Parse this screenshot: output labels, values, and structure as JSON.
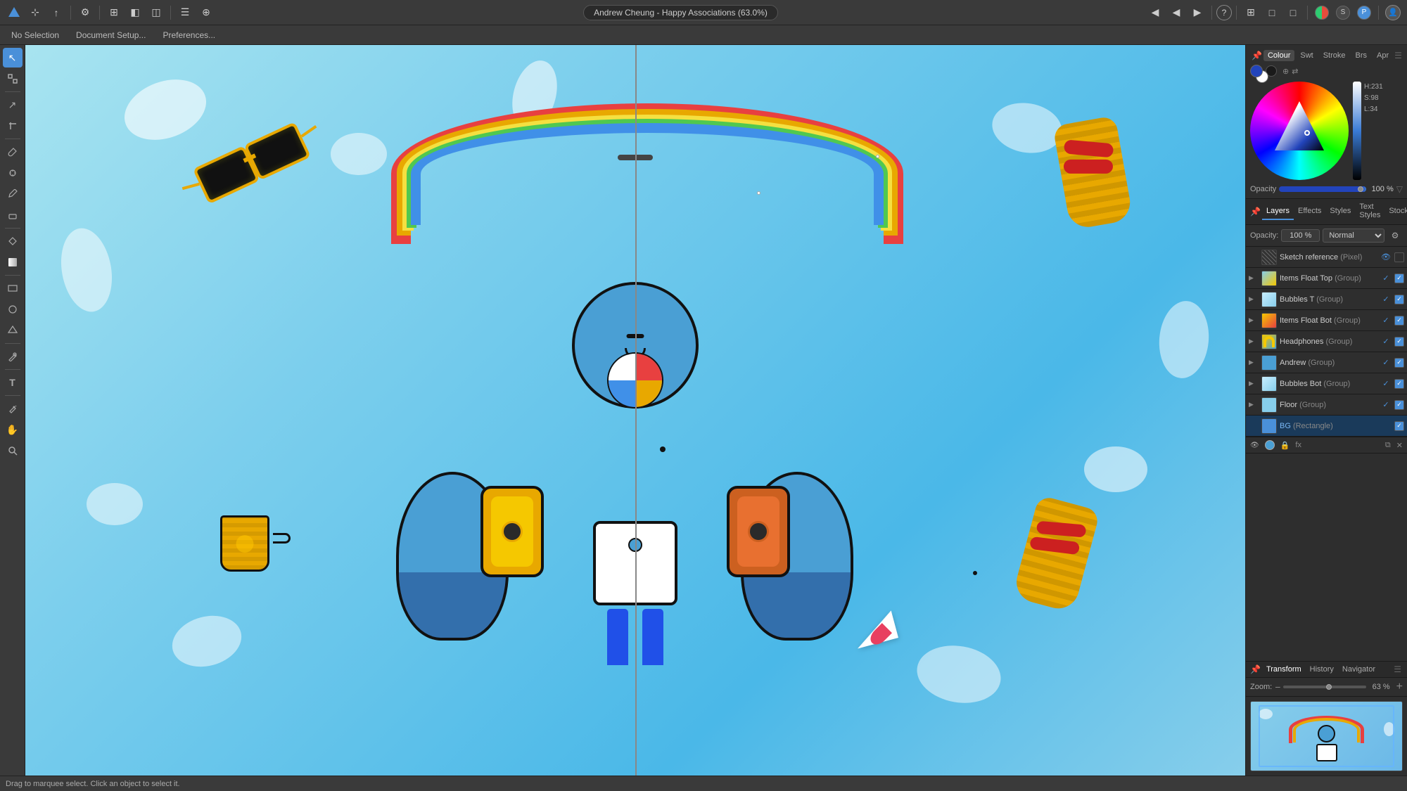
{
  "app": {
    "title": "Andrew Cheung - Happy Associations (63.0%)",
    "zoom_level": "63 %"
  },
  "top_toolbar": {
    "tools": [
      {
        "name": "affinity-logo",
        "icon": "✦",
        "active": false
      },
      {
        "name": "move-tool",
        "icon": "⊹",
        "active": false
      },
      {
        "name": "export",
        "icon": "↑",
        "active": false
      },
      {
        "name": "preferences",
        "icon": "⚙",
        "active": false
      },
      {
        "name": "grid",
        "icon": "⊞",
        "active": false
      },
      {
        "name": "view1",
        "icon": "▦",
        "active": false
      },
      {
        "name": "view2",
        "icon": "◧",
        "active": false
      }
    ],
    "right_tools": [
      {
        "name": "align",
        "icon": "◀",
        "active": false
      },
      {
        "name": "zoom-in",
        "icon": "◀",
        "active": false
      },
      {
        "name": "zoom-out",
        "icon": "▶",
        "active": false
      },
      {
        "name": "help",
        "icon": "?",
        "active": false
      },
      {
        "name": "info",
        "icon": "ⓘ",
        "active": false
      },
      {
        "name": "view-mode",
        "icon": "⊞",
        "active": false
      },
      {
        "name": "toggle1",
        "icon": "□",
        "active": false
      },
      {
        "name": "toggle2",
        "icon": "□",
        "active": false
      },
      {
        "name": "placeholder1",
        "icon": "",
        "active": false
      },
      {
        "name": "placeholder2",
        "icon": "",
        "active": false
      },
      {
        "name": "account",
        "icon": "👤",
        "active": false
      }
    ]
  },
  "secondary_toolbar": {
    "items": [
      {
        "name": "no-selection",
        "label": "No Selection"
      },
      {
        "name": "document-setup",
        "label": "Document Setup..."
      },
      {
        "name": "preferences",
        "label": "Preferences..."
      }
    ]
  },
  "left_tools": {
    "tools": [
      {
        "name": "select-tool",
        "icon": "↖",
        "active": true
      },
      {
        "name": "node-tool",
        "icon": "▣",
        "active": false
      },
      {
        "name": "crop-tool",
        "icon": "↗",
        "active": false
      },
      {
        "name": "paint-brush",
        "icon": "✏",
        "active": false
      },
      {
        "name": "vector-brush",
        "icon": "⌒",
        "active": false
      },
      {
        "name": "pencil-tool",
        "icon": "✒",
        "active": false
      },
      {
        "name": "fill-tool",
        "icon": "▲",
        "active": false
      },
      {
        "name": "gradient-tool",
        "icon": "◇",
        "active": false
      },
      {
        "name": "transparency-tool",
        "icon": "◈",
        "active": false
      },
      {
        "name": "shape-tool",
        "icon": "□",
        "active": false
      },
      {
        "name": "pen-tool",
        "icon": "✐",
        "active": false
      },
      {
        "name": "text-tool",
        "icon": "T",
        "active": false
      },
      {
        "name": "sample-tool",
        "icon": "✦",
        "active": false
      },
      {
        "name": "hand-tool",
        "icon": "✋",
        "active": false
      },
      {
        "name": "zoom-tool",
        "icon": "🔍",
        "active": false
      }
    ]
  },
  "colour_panel": {
    "tabs": [
      {
        "name": "colour",
        "label": "Colour",
        "active": true
      },
      {
        "name": "swatches",
        "label": "Swt",
        "active": false
      },
      {
        "name": "stroke",
        "label": "Stroke",
        "active": false
      },
      {
        "name": "brushes",
        "label": "Brs",
        "active": false
      },
      {
        "name": "appearance",
        "label": "Apr",
        "active": false
      }
    ],
    "hsl": {
      "h_label": "H:",
      "h_value": "231",
      "s_label": "S:",
      "s_value": "98",
      "l_label": "L:",
      "l_value": "34"
    },
    "opacity_label": "Opacity",
    "opacity_value": "100 %"
  },
  "layers_panel": {
    "tabs": [
      {
        "name": "layers-tab",
        "label": "Layers",
        "active": true
      },
      {
        "name": "effects-tab",
        "label": "Effects",
        "active": false
      },
      {
        "name": "styles-tab",
        "label": "Styles",
        "active": false
      },
      {
        "name": "text-styles-tab",
        "label": "Text Styles",
        "active": false
      },
      {
        "name": "stock-tab",
        "label": "Stock",
        "active": false
      }
    ],
    "opacity_label": "Opacity:",
    "opacity_value": "100 %",
    "blend_mode": "Normal",
    "layers": [
      {
        "name": "Sketch reference",
        "type": "Pixel",
        "visible": true,
        "checked": false,
        "thumb_type": "sketch"
      },
      {
        "name": "Items Float Top",
        "type": "Group",
        "visible": true,
        "checked": true,
        "thumb_type": "group",
        "expanded": false
      },
      {
        "name": "Bubbles T",
        "type": "Group",
        "visible": true,
        "checked": true,
        "thumb_type": "group",
        "expanded": false
      },
      {
        "name": "Items Float Bot",
        "type": "Group",
        "visible": true,
        "checked": true,
        "thumb_type": "group",
        "expanded": false
      },
      {
        "name": "Headphones",
        "type": "Group",
        "visible": true,
        "checked": true,
        "thumb_type": "headphones",
        "expanded": false
      },
      {
        "name": "Andrew",
        "type": "Group",
        "visible": true,
        "checked": true,
        "thumb_type": "andrew",
        "expanded": false
      },
      {
        "name": "Bubbles Bot",
        "type": "Group",
        "visible": true,
        "checked": true,
        "thumb_type": "group",
        "expanded": false
      },
      {
        "name": "Floor",
        "type": "Group",
        "visible": true,
        "checked": true,
        "thumb_type": "group",
        "expanded": false
      },
      {
        "name": "BG",
        "type": "Rectangle",
        "visible": true,
        "checked": true,
        "thumb_type": "blue",
        "selected": true,
        "expanded": false
      }
    ]
  },
  "bottom_panel": {
    "tabs": [
      {
        "name": "transform-tab",
        "label": "Transform",
        "active": true
      },
      {
        "name": "history-tab",
        "label": "History",
        "active": false
      },
      {
        "name": "navigator-tab",
        "label": "Navigator",
        "active": false
      }
    ],
    "zoom_label": "Zoom:",
    "zoom_value": "63 %"
  },
  "status_bar": {
    "message": "Drag to marquee select. Click an object to select it."
  }
}
